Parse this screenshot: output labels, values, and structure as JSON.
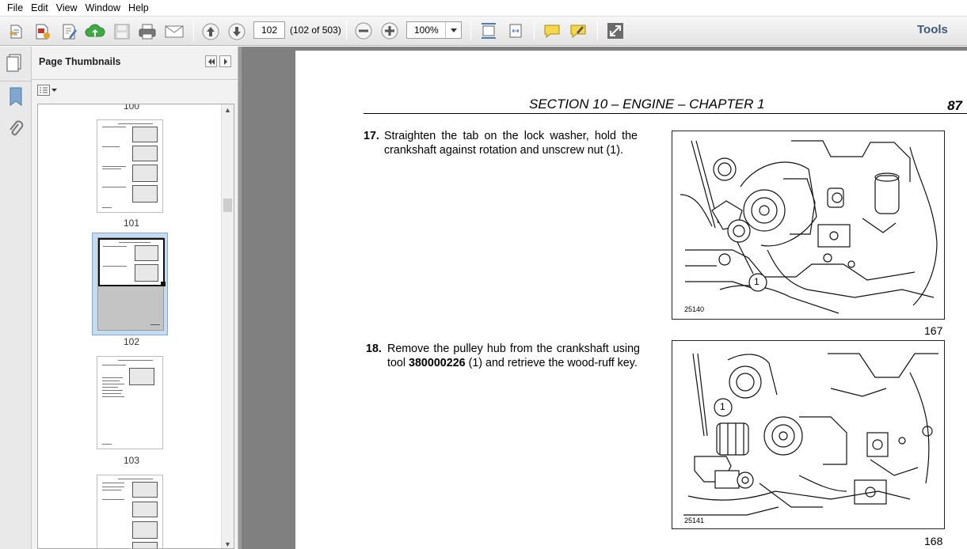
{
  "menu": [
    "File",
    "Edit",
    "View",
    "Window",
    "Help"
  ],
  "toolbar": {
    "page_input": "102",
    "page_count": "(102 of 503)",
    "zoom": "100%",
    "tools_label": "Tools"
  },
  "sidebar": {
    "title": "Page Thumbnails",
    "thumbnails": [
      {
        "label": "100"
      },
      {
        "label": "101"
      },
      {
        "label": "102"
      },
      {
        "label": "103"
      }
    ]
  },
  "document": {
    "header_title": "SECTION 10 – ENGINE – CHAPTER 1",
    "page_number": "87",
    "steps": [
      {
        "number": "17.",
        "text": "Straighten the tab on the lock washer, hold the crankshaft against rotation and unscrew nut (1).",
        "figure_code": "25140",
        "figure_number": "167",
        "callout": "1"
      },
      {
        "number": "18.",
        "text_before": "Remove the pulley hub from the crankshaft using tool ",
        "tool_code": "380000226",
        "text_after": " (1) and retrieve the wood-ruff key.",
        "figure_code": "25141",
        "figure_number": "168",
        "callout": "1"
      }
    ]
  }
}
